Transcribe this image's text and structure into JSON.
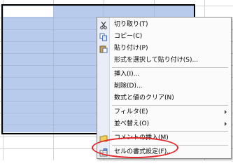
{
  "sheet": {
    "selection_fill_color": "#b9cbec",
    "selection_border_color": "#000000"
  },
  "context_menu": {
    "items": [
      {
        "label": "切り取り(T)",
        "icon": "scissors-icon",
        "submenu": false
      },
      {
        "label": "コピー(C)",
        "icon": "copy-icon",
        "submenu": false
      },
      {
        "label": "貼り付け(P)",
        "icon": "paste-icon",
        "submenu": false
      },
      {
        "label": "形式を選択して貼り付け(S)...",
        "icon": "",
        "submenu": false
      },
      {
        "label": "挿入(I)...",
        "icon": "",
        "submenu": false
      },
      {
        "label": "削除(D)...",
        "icon": "",
        "submenu": false
      },
      {
        "label": "数式と値のクリア(N)",
        "icon": "",
        "submenu": false
      },
      {
        "label": "フィルタ(E)",
        "icon": "",
        "submenu": true
      },
      {
        "label": "並べ替え(O)",
        "icon": "",
        "submenu": true
      },
      {
        "label": "コメントの挿入(M)",
        "icon": "comment-icon",
        "submenu": false
      },
      {
        "label": "セルの書式設定(F)...",
        "icon": "format-cells-icon",
        "submenu": false
      }
    ]
  },
  "annotation": {
    "highlight_color": "#e3262a",
    "highlighted_item": "セルの書式設定(F)..."
  }
}
